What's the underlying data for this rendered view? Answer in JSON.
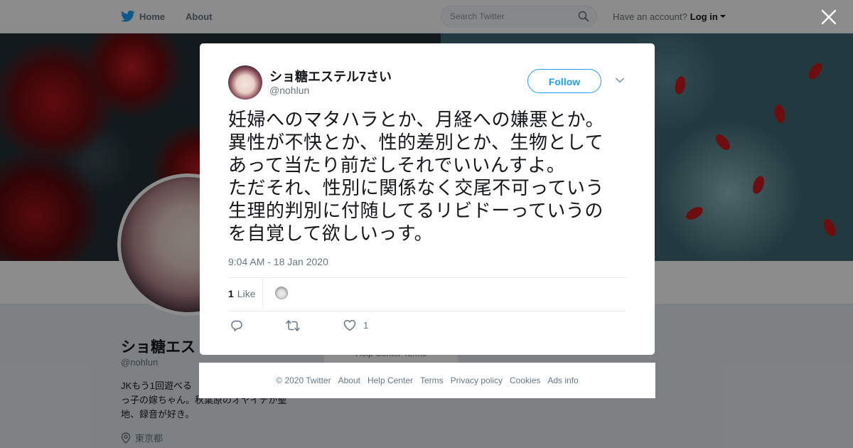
{
  "topbar": {
    "home_label": "Home",
    "about_label": "About",
    "search_placeholder": "Search Twitter",
    "account_prompt": "Have an account?",
    "login_label": "Log in"
  },
  "profile": {
    "name": "ショ糖エス",
    "handle": "@nohlun",
    "bio": "JKもう1回遊べる\nっ子の嫁ちゃん。秋葉原のオヤイテが聖\n地、録音が好き。",
    "location": "東京都",
    "behind_links": "Help Center   Terms"
  },
  "tweet": {
    "author_name": "ショ糖エステル7さい",
    "author_handle": "@nohlun",
    "follow_label": "Follow",
    "text": "妊婦へのマタハラとか、月経への嫌悪とか。\n異性が不快とか、性的差別とか、生物として\nあって当たり前だしそれでいいんすよ。\nただそれ、性別に関係なく交尾不可っていう\n生理的判別に付随してるリビドーっていうの\nを自覚して欲しいっす。",
    "timestamp": "9:04 AM - 18 Jan 2020",
    "like_count": "1",
    "like_label": "Like",
    "like_action_count": "1"
  },
  "footer": {
    "copyright": "© 2020 Twitter",
    "links": [
      "About",
      "Help Center",
      "Terms",
      "Privacy policy",
      "Cookies",
      "Ads info"
    ]
  },
  "colors": {
    "brand": "#1da1f2",
    "text_primary": "#14171a",
    "text_secondary": "#657786"
  },
  "icons": [
    "twitter-bird-icon",
    "search-icon",
    "caret-down-icon",
    "close-icon",
    "reply-icon",
    "retweet-icon",
    "heart-icon",
    "location-pin-icon"
  ]
}
